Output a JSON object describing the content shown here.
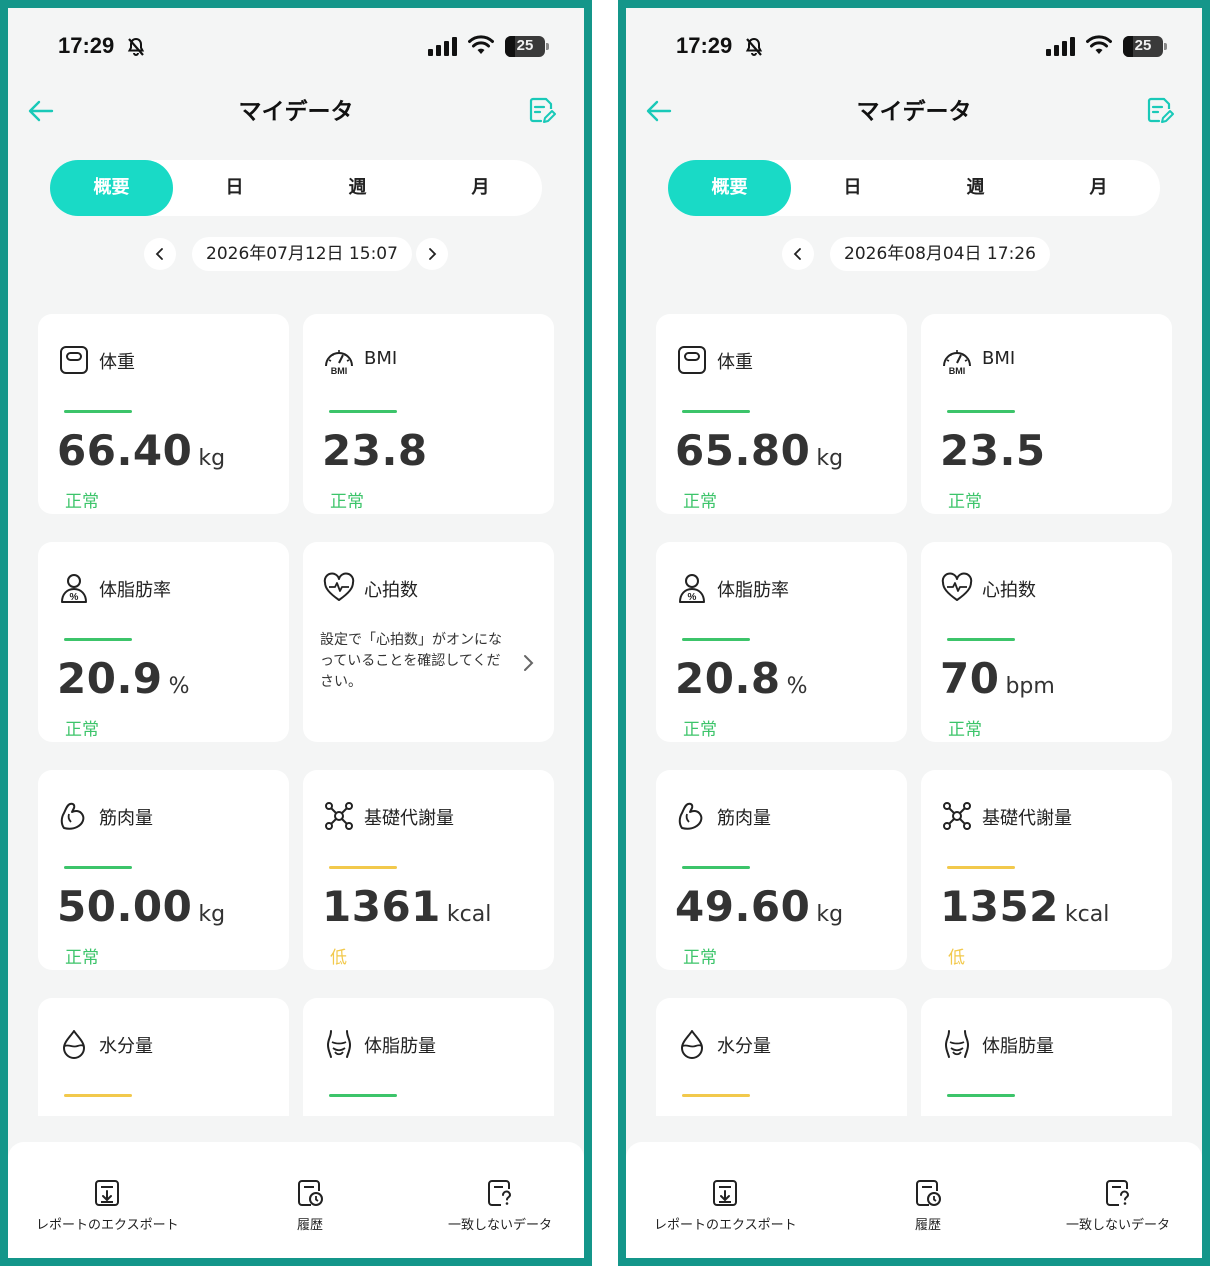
{
  "status_bar": {
    "time": "17:29",
    "battery": "25",
    "battery_level": 0.25
  },
  "nav": {
    "title": "マイデータ"
  },
  "tabs": [
    {
      "label": "概要",
      "active": true
    },
    {
      "label": "日",
      "active": false
    },
    {
      "label": "週",
      "active": false
    },
    {
      "label": "月",
      "active": false
    }
  ],
  "colors": {
    "accent": "#19dac6",
    "normal": "#3cc46a",
    "low": "#f2c94c"
  },
  "screens": [
    {
      "date": "2026年07月12日 15:07",
      "cards": [
        {
          "label": "体重",
          "icon": "scale-icon",
          "value": "66.40",
          "unit": "kg",
          "status": "正常",
          "level": "normal"
        },
        {
          "label": "BMI",
          "icon": "bmi-gauge-icon",
          "value": "23.8",
          "unit": "",
          "status": "正常",
          "level": "normal"
        },
        {
          "label": "体脂肪率",
          "icon": "body-fat-percent-icon",
          "value": "20.9",
          "unit": "%",
          "status": "正常",
          "level": "normal"
        },
        {
          "label": "心拍数",
          "icon": "heart-rate-icon",
          "message": "設定で「心拍数」がオンになっていることを確認してください。"
        },
        {
          "label": "筋肉量",
          "icon": "muscle-icon",
          "value": "50.00",
          "unit": "kg",
          "status": "正常",
          "level": "normal"
        },
        {
          "label": "基礎代謝量",
          "icon": "metabolism-icon",
          "value": "1361",
          "unit": "kcal",
          "status": "低",
          "level": "low"
        },
        {
          "label": "水分量",
          "icon": "water-drop-icon",
          "value": "",
          "unit": "",
          "status": "",
          "level": "low"
        },
        {
          "label": "体脂肪量",
          "icon": "body-fat-mass-icon",
          "value": "",
          "unit": "",
          "status": "",
          "level": "normal"
        }
      ]
    },
    {
      "date": "2026年08月04日 17:26",
      "cards": [
        {
          "label": "体重",
          "icon": "scale-icon",
          "value": "65.80",
          "unit": "kg",
          "status": "正常",
          "level": "normal"
        },
        {
          "label": "BMI",
          "icon": "bmi-gauge-icon",
          "value": "23.5",
          "unit": "",
          "status": "正常",
          "level": "normal"
        },
        {
          "label": "体脂肪率",
          "icon": "body-fat-percent-icon",
          "value": "20.8",
          "unit": "%",
          "status": "正常",
          "level": "normal"
        },
        {
          "label": "心拍数",
          "icon": "heart-rate-icon",
          "value": "70",
          "unit": "bpm",
          "status": "正常",
          "level": "normal"
        },
        {
          "label": "筋肉量",
          "icon": "muscle-icon",
          "value": "49.60",
          "unit": "kg",
          "status": "正常",
          "level": "normal"
        },
        {
          "label": "基礎代謝量",
          "icon": "metabolism-icon",
          "value": "1352",
          "unit": "kcal",
          "status": "低",
          "level": "low"
        },
        {
          "label": "水分量",
          "icon": "water-drop-icon",
          "value": "",
          "unit": "",
          "status": "",
          "level": "low"
        },
        {
          "label": "体脂肪量",
          "icon": "body-fat-mass-icon",
          "value": "",
          "unit": "",
          "status": "",
          "level": "normal"
        }
      ]
    }
  ],
  "bottom_bar": [
    {
      "label": "レポートのエクスポート",
      "icon": "export-report-icon"
    },
    {
      "label": "履歴",
      "icon": "history-icon"
    },
    {
      "label": "一致しないデータ",
      "icon": "unmatched-data-icon"
    }
  ]
}
